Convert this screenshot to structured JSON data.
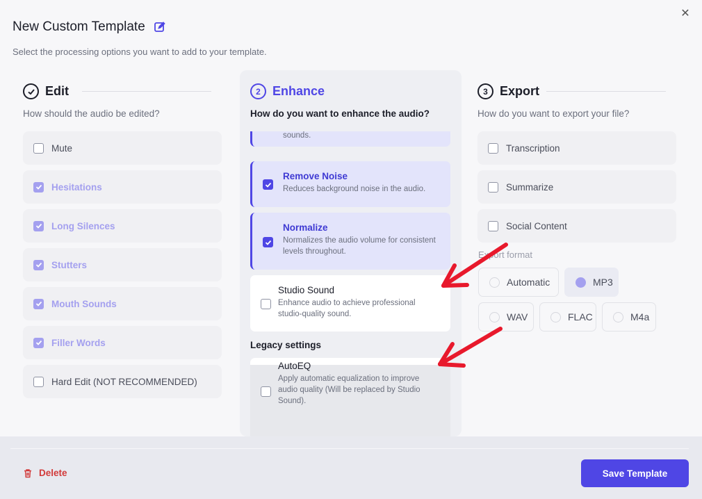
{
  "header": {
    "title": "New Custom Template",
    "subtitle": "Select the processing options you want to add to your template."
  },
  "edit": {
    "step": "",
    "title": "Edit",
    "question": "How should the audio be edited?",
    "options": [
      {
        "label": "Mute",
        "checked": false
      },
      {
        "label": "Hesitations",
        "checked": true
      },
      {
        "label": "Long Silences",
        "checked": true
      },
      {
        "label": "Stutters",
        "checked": true
      },
      {
        "label": "Mouth Sounds",
        "checked": true
      },
      {
        "label": "Filler Words",
        "checked": true
      },
      {
        "label": "Hard Edit (NOT RECOMMENDED)",
        "checked": false
      }
    ]
  },
  "enhance": {
    "step": "2",
    "title": "Enhance",
    "question": "How do you want to enhance the audio?",
    "cards": [
      {
        "title": "",
        "desc": "sounds.",
        "checked": true
      },
      {
        "title": "Remove Noise",
        "desc": "Reduces background noise in the audio.",
        "checked": true
      },
      {
        "title": "Normalize",
        "desc": "Normalizes the audio volume for consistent levels throughout.",
        "checked": true
      },
      {
        "title": "Studio Sound",
        "desc": "Enhance audio to achieve professional studio-quality sound.",
        "checked": false
      }
    ],
    "legacy_label": "Legacy settings",
    "legacy_cards": [
      {
        "title": "AutoEQ",
        "desc": "Apply automatic equalization to improve audio quality (Will be replaced by Studio Sound).",
        "checked": false
      }
    ]
  },
  "export": {
    "step": "3",
    "title": "Export",
    "question": "How do you want to export your file?",
    "options": [
      {
        "label": "Transcription",
        "checked": false
      },
      {
        "label": "Summarize",
        "checked": false
      },
      {
        "label": "Social Content",
        "checked": false
      }
    ],
    "format_label": "Export format",
    "formats": [
      {
        "label": "Automatic",
        "selected": false
      },
      {
        "label": "MP3",
        "selected": true
      },
      {
        "label": "WAV",
        "selected": false
      },
      {
        "label": "FLAC",
        "selected": false
      },
      {
        "label": "M4a",
        "selected": false
      }
    ]
  },
  "footer": {
    "delete_label": "Delete",
    "save_label": "Save Template"
  },
  "colors": {
    "accent": "#4f46e5",
    "accent_faded": "#a4a0ef",
    "danger": "#d23a3a",
    "annotation_arrow": "#e8192c"
  }
}
